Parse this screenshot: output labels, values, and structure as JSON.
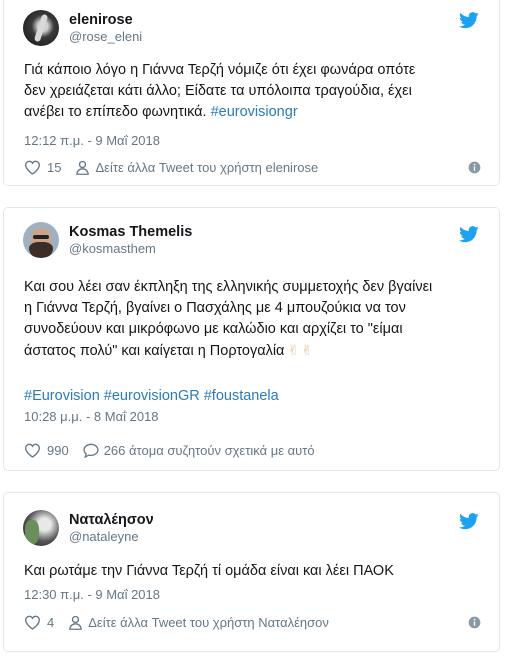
{
  "brand": {
    "twitter_color": "#1da1f2",
    "link_color": "#2b7bb9"
  },
  "tweets": [
    {
      "display_name": "elenirose",
      "handle": "@rose_eleni",
      "text_line1": "Γιά κάποιο λόγο η Γιάννα Τερζή νόμιζε ότι έχει φωνάρα οπότε",
      "text_line2": "δεν χρειάζεται κάτι άλλο; Είδατε τα υπόλοιπα τραγούδια, έχει",
      "text_line3_plain": "ανέβει το επίπεδο φωνητικά.",
      "hashtag": "#eurovisiongr",
      "timestamp": "12:12 π.μ. - 9 Μαΐ 2018",
      "like_count": "15",
      "more_text": "Δείτε άλλα Tweet του χρήστη elenirose"
    },
    {
      "display_name": "Kosmas Themelis",
      "handle": "@kosmasthem",
      "text_line1": "Και σου λέει σαν έκπληξη της ελληνικής συμμετοχής δεν βγαίνει",
      "text_line2": "η Γιάννα Τερζή, βγαίνει ο Πασχάλης με 4 μπουζούκια να τον",
      "text_line3": "συνοδεύουν και μικρόφωνο με καλώδιο και αρχίζει το \"είμαι",
      "text_line4_plain": "άστατος πολύ\" και καίγεται η Πορτογαλία",
      "emoji": "✌✌",
      "hashtags": "#Eurovision #eurovisionGR #foustanela",
      "timestamp": "10:28 μ.μ. - 8 Μαΐ 2018",
      "like_count": "990",
      "discuss_text": "266 άτομα συζητούν σχετικά με αυτό"
    },
    {
      "display_name": "Ναταλέησον",
      "handle": "@nataleyne",
      "text_line1": "Και ρωτάμε την Γιάννα Τερζή τί ομάδα είναι και λέει ΠΑΟΚ",
      "timestamp": "12:30 π.μ. - 9 Μαΐ 2018",
      "like_count": "4",
      "more_text": "Δείτε άλλα Tweet του χρήστη Ναταλέησον"
    }
  ]
}
